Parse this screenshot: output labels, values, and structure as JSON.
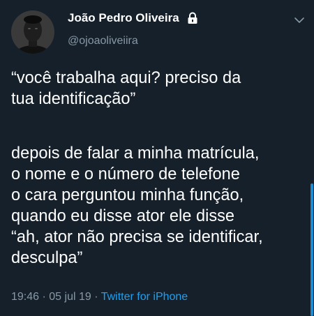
{
  "user": {
    "display_name": "João Pedro Oliveira",
    "handle": "@ojoaoliveiira",
    "protected": true
  },
  "tweet": {
    "paragraph1": [
      "“você trabalha aqui? preciso da",
      "tua identificação”"
    ],
    "paragraph2": [
      "depois de falar a minha matrícula,",
      "o nome e o número de telefone",
      "o cara perguntou minha função,",
      "quando eu disse ator ele disse",
      "“ah, ator não precisa se identificar,",
      "desculpa”"
    ]
  },
  "meta": {
    "time": "19:46",
    "separator1": " · ",
    "date": "05 jul 19",
    "separator2": " · ",
    "source": "Twitter for iPhone"
  },
  "icons": {
    "lock": "lock-icon",
    "chevron": "chevron-down-icon",
    "avatar": "avatar"
  },
  "colors": {
    "background": "#15202b",
    "text": "#ffffff",
    "muted": "#8899a6",
    "accent": "#1da1f2"
  }
}
